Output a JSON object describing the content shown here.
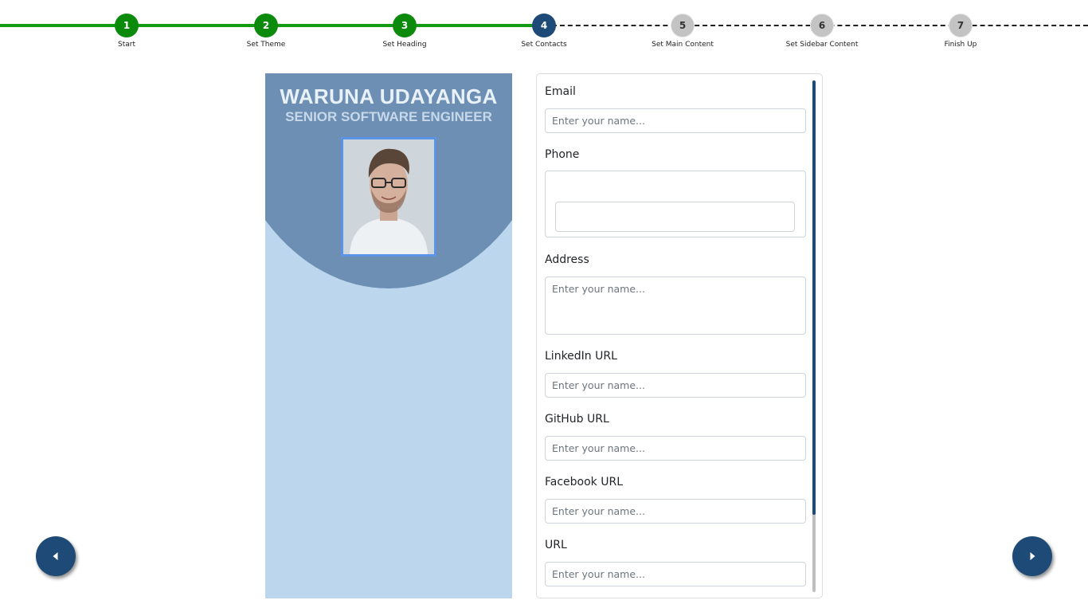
{
  "stepper": {
    "steps": [
      {
        "number": "1",
        "label": "Start",
        "state": "done"
      },
      {
        "number": "2",
        "label": "Set Theme",
        "state": "done"
      },
      {
        "number": "3",
        "label": "Set Heading",
        "state": "done"
      },
      {
        "number": "4",
        "label": "Set Contacts",
        "state": "active"
      },
      {
        "number": "5",
        "label": "Set Main Content",
        "state": "todo"
      },
      {
        "number": "6",
        "label": "Set Sidebar Content",
        "state": "todo"
      },
      {
        "number": "7",
        "label": "Finish Up",
        "state": "todo"
      }
    ],
    "colors": {
      "done": "#0b8a0b",
      "active": "#1d4a77",
      "todo": "#c3c3c3"
    }
  },
  "preview": {
    "name": "WARUNA UDAYANGA",
    "title": "SENIOR SOFTWARE ENGINEER",
    "colors": {
      "header": "#6c8fb3",
      "body": "#bcd6ed",
      "photo_border": "#5b93e6"
    }
  },
  "form": {
    "email": {
      "label": "Email",
      "placeholder": "Enter your name...",
      "value": ""
    },
    "phone": {
      "label": "Phone",
      "value": ""
    },
    "address": {
      "label": "Address",
      "placeholder": "Enter your name...",
      "value": ""
    },
    "linkedin": {
      "label": "LinkedIn URL",
      "placeholder": "Enter your name...",
      "value": ""
    },
    "github": {
      "label": "GitHub URL",
      "placeholder": "Enter your name...",
      "value": ""
    },
    "facebook": {
      "label": "Facebook URL",
      "placeholder": "Enter your name...",
      "value": ""
    },
    "url": {
      "label": "URL",
      "placeholder": "Enter your name...",
      "value": ""
    }
  },
  "nav": {
    "prev_icon": "caret-left-icon",
    "next_icon": "caret-right-icon",
    "color": "#1d4a77"
  }
}
